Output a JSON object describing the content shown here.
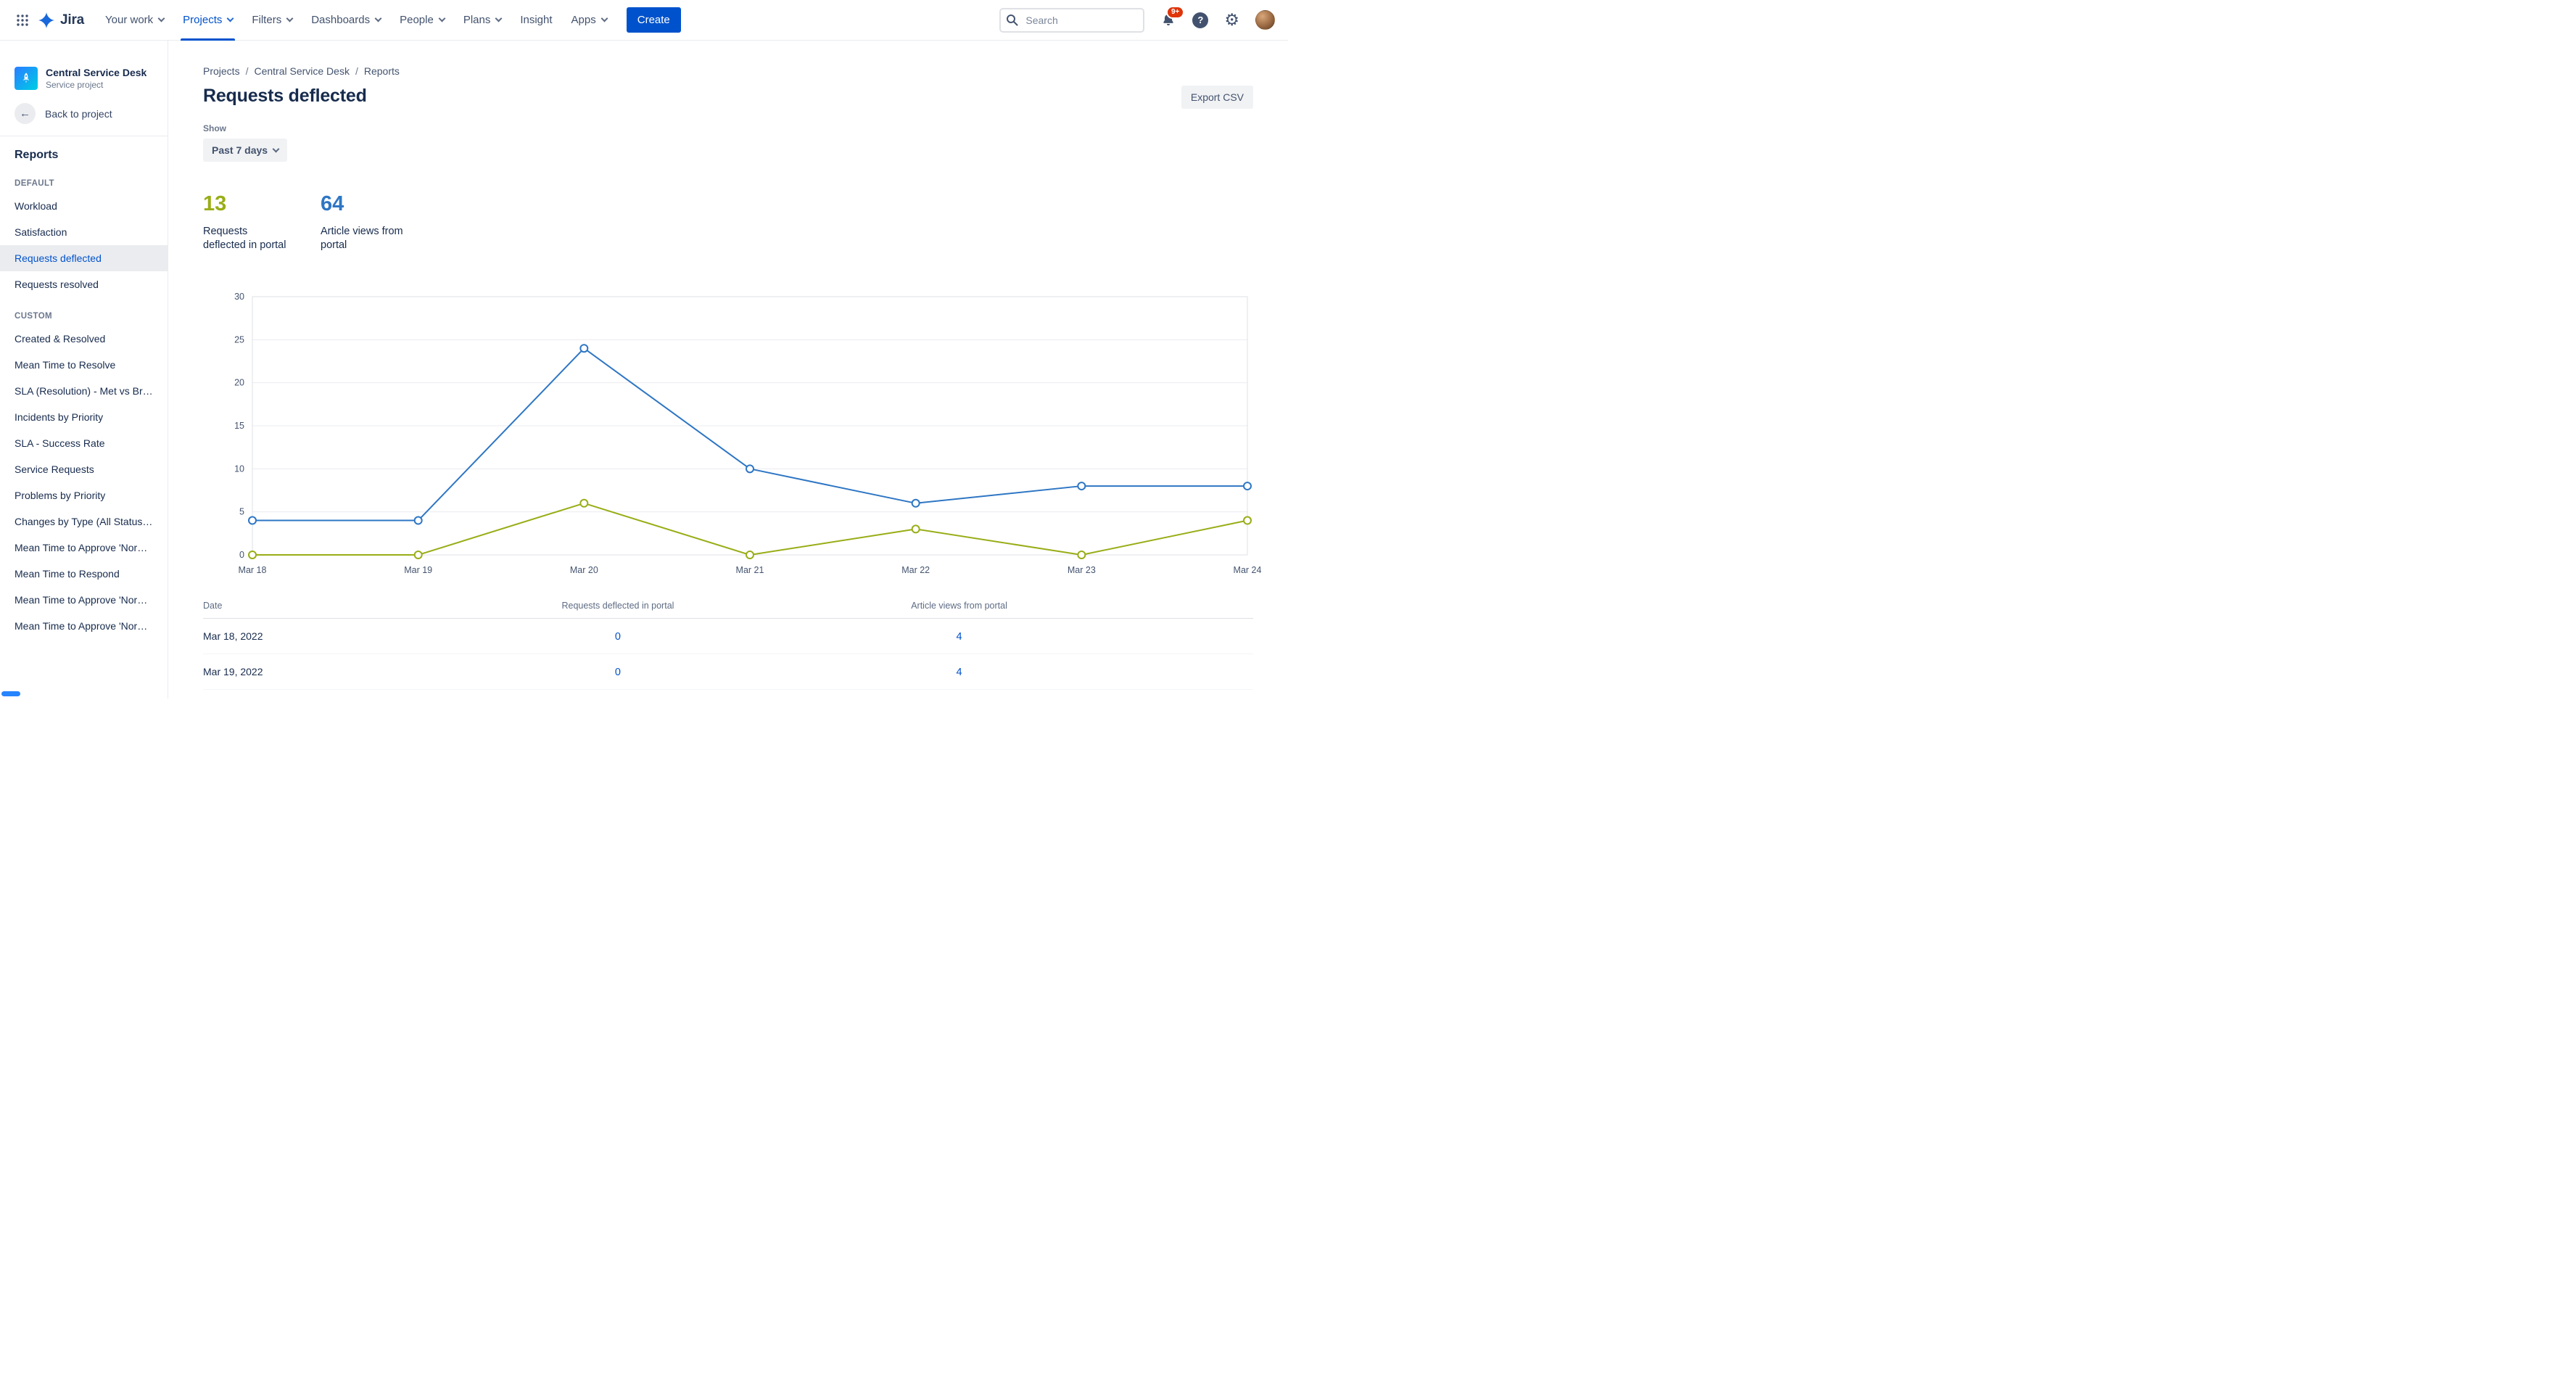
{
  "colors": {
    "accent": "#0052CC",
    "selection_bg": "#EBECF0",
    "badge_red": "#DE350B",
    "chart_blue": "#2E76C4",
    "chart_green": "#99AD16"
  },
  "nav": {
    "brand": "Jira",
    "items": [
      {
        "label": "Your work",
        "chevron": true,
        "active": false
      },
      {
        "label": "Projects",
        "chevron": true,
        "active": true
      },
      {
        "label": "Filters",
        "chevron": true,
        "active": false
      },
      {
        "label": "Dashboards",
        "chevron": true,
        "active": false
      },
      {
        "label": "People",
        "chevron": true,
        "active": false
      },
      {
        "label": "Plans",
        "chevron": true,
        "active": false
      },
      {
        "label": "Insight",
        "chevron": false,
        "active": false
      },
      {
        "label": "Apps",
        "chevron": true,
        "active": false
      }
    ],
    "create_label": "Create",
    "search_placeholder": "Search",
    "notification_badge": "9+",
    "help_glyph": "?"
  },
  "sidebar": {
    "project_name": "Central Service Desk",
    "project_type": "Service project",
    "back_label": "Back to project",
    "section_title": "Reports",
    "groups": [
      {
        "label": "DEFAULT",
        "items": [
          {
            "label": "Workload",
            "selected": false
          },
          {
            "label": "Satisfaction",
            "selected": false
          },
          {
            "label": "Requests deflected",
            "selected": true
          },
          {
            "label": "Requests resolved",
            "selected": false
          }
        ]
      },
      {
        "label": "CUSTOM",
        "items": [
          {
            "label": "Created & Resolved",
            "selected": false
          },
          {
            "label": "Mean Time to Resolve",
            "selected": false
          },
          {
            "label": "SLA (Resolution) - Met vs Bre...",
            "selected": false
          },
          {
            "label": "Incidents by Priority",
            "selected": false
          },
          {
            "label": "SLA - Success Rate",
            "selected": false
          },
          {
            "label": "Service Requests",
            "selected": false
          },
          {
            "label": "Problems by Priority",
            "selected": false
          },
          {
            "label": "Changes by Type (All Statuses)",
            "selected": false
          },
          {
            "label": "Mean Time to Approve 'Norm...",
            "selected": false
          },
          {
            "label": "Mean Time to Respond",
            "selected": false
          },
          {
            "label": "Mean Time to Approve 'Norm...",
            "selected": false
          },
          {
            "label": "Mean Time to Approve 'Norm...",
            "selected": false
          }
        ]
      }
    ]
  },
  "breadcrumb": [
    "Projects",
    "Central Service Desk",
    "Reports"
  ],
  "page": {
    "title": "Requests deflected",
    "export_label": "Export CSV",
    "show_label": "Show",
    "range_value": "Past 7 days"
  },
  "stats": [
    {
      "value": "13",
      "label": "Requests deflected in portal",
      "color": "#99AD16"
    },
    {
      "value": "64",
      "label": "Article views from portal",
      "color": "#2E76C4"
    }
  ],
  "chart_data": {
    "type": "line",
    "x": [
      "Mar 18",
      "Mar 19",
      "Mar 20",
      "Mar 21",
      "Mar 22",
      "Mar 23",
      "Mar 24"
    ],
    "series": [
      {
        "name": "Article views from portal",
        "color": "#2E76C4",
        "values": [
          4,
          4,
          24,
          10,
          6,
          8,
          8
        ]
      },
      {
        "name": "Requests deflected in portal",
        "color": "#99AD16",
        "values": [
          0,
          0,
          6,
          0,
          3,
          0,
          4
        ]
      }
    ],
    "title": "",
    "xlabel": "",
    "ylabel": "",
    "ylim": [
      0,
      30
    ],
    "yticks": [
      0,
      5,
      10,
      15,
      20,
      25,
      30
    ],
    "grid": "horizontal",
    "legend": "none"
  },
  "table": {
    "columns": [
      "Date",
      "Requests deflected in portal",
      "Article views from portal"
    ],
    "rows": [
      [
        "Mar 18, 2022",
        "0",
        "4"
      ],
      [
        "Mar 19, 2022",
        "0",
        "4"
      ]
    ]
  }
}
